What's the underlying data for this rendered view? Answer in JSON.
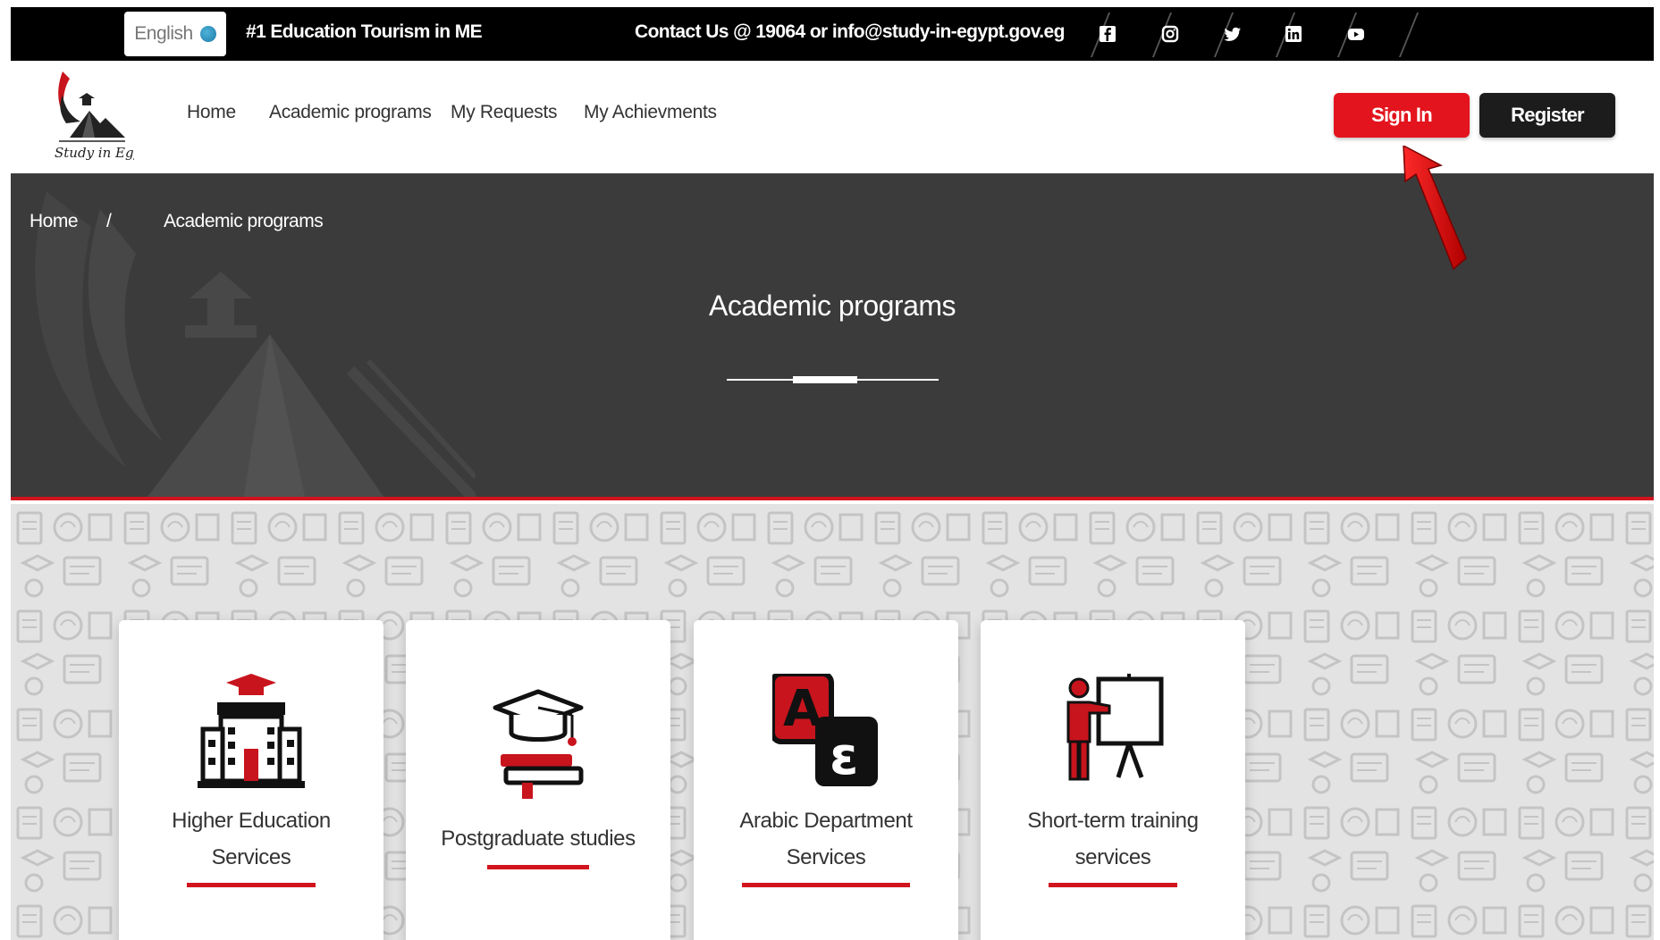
{
  "topbar": {
    "language": "English",
    "tagline": "#1 Education Tourism in ME",
    "contact": "Contact Us @ 19064 or info@study-in-egypt.gov.eg",
    "social": [
      "facebook-icon",
      "instagram-icon",
      "twitter-icon",
      "linkedin-icon",
      "youtube-icon"
    ]
  },
  "logo": {
    "text": "Study in Egypt"
  },
  "nav": {
    "links": [
      "Home",
      "Academic programs",
      "My Requests",
      "My Achievments"
    ],
    "signin": "Sign In",
    "register": "Register"
  },
  "hero": {
    "breadcrumb": {
      "home": "Home",
      "separator": "/",
      "current": "Academic programs"
    },
    "title": "Academic programs"
  },
  "cards": [
    {
      "title_line1": "Higher Education",
      "title_line2": "Services",
      "icon": "university-building-icon"
    },
    {
      "title_line1": "Postgraduate studies",
      "title_line2": "",
      "icon": "graduation-cap-books-icon"
    },
    {
      "title_line1": "Arabic Department",
      "title_line2": "Services",
      "icon": "arabic-letters-icon"
    },
    {
      "title_line1": "Short-term training",
      "title_line2": "services",
      "icon": "teacher-board-icon"
    }
  ],
  "colors": {
    "accent": "#e3141d",
    "dark": "#1c1c1c",
    "hero": "#3b3b3b"
  }
}
